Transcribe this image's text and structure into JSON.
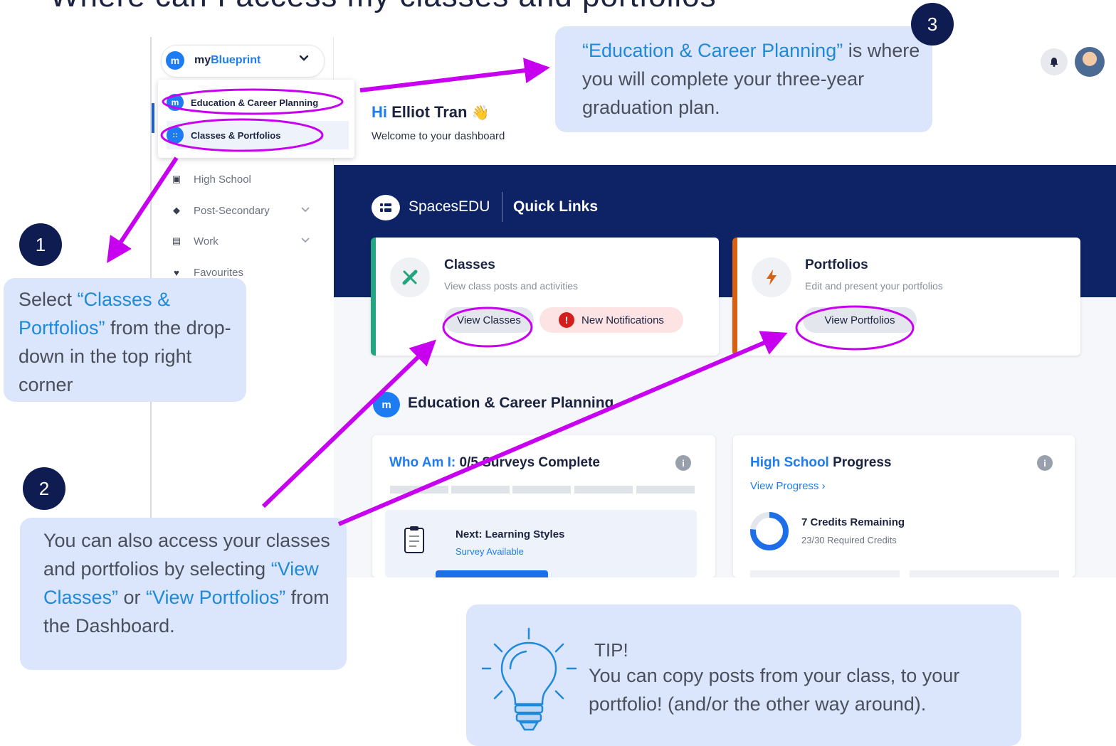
{
  "heading": "Where can I access my classes and portfolios",
  "sidebar": {
    "app_switcher": {
      "logo": "m",
      "name_prefix": "my",
      "name_brand": "Blueprint",
      "chevron": "⌄"
    },
    "dropdown": [
      {
        "label": "Education & Career Planning",
        "icon": "m"
      },
      {
        "label": "Classes & Portfolios",
        "icon": "::"
      }
    ],
    "nav": [
      {
        "label": "High School",
        "icon": "school-icon"
      },
      {
        "label": "Post-Secondary",
        "icon": "graduation-cap-icon"
      },
      {
        "label": "Work",
        "icon": "briefcase-icon"
      },
      {
        "label": "Favourites",
        "icon": "heart-icon"
      }
    ]
  },
  "header": {
    "hi": "Hi",
    "name": "Elliot Tran",
    "wave": "👋",
    "welcome": "Welcome to your dashboard"
  },
  "quick_links": {
    "brand": "SpacesEDU",
    "title": "Quick Links",
    "classes": {
      "title": "Classes",
      "subtitle": "View class posts and activities",
      "button": "View Classes",
      "notifications": "New Notifications"
    },
    "portfolios": {
      "title": "Portfolios",
      "subtitle": "Edit and present your portfolios",
      "button": "View Portfolios"
    }
  },
  "ecp": {
    "title": "Education & Career Planning",
    "who_am_i": {
      "prefix": "Who Am I:",
      "rest": "0/5 Surveys Complete",
      "segments": 5,
      "next_title": "Next: Learning Styles",
      "next_sub": "Survey Available"
    },
    "high_school": {
      "title_blue": "High School",
      "title_rest": "Progress",
      "link": "View Progress",
      "credits": "7 Credits Remaining",
      "required": "23/30 Required Credits",
      "progress_fraction": 0.767
    }
  },
  "callouts": {
    "one": {
      "number": "1",
      "pre": "Select ",
      "link": "“Classes & Portfolios”",
      "post": "  from the drop-down in the top right corner"
    },
    "two": {
      "number": "2",
      "pre": "You can also access your classes and portfolios by selecting ",
      "link1": "“View Classes”",
      "mid": " or ",
      "link2": "“View Portfolios”",
      "post": " from the Dashboard."
    },
    "three": {
      "number": "3",
      "link": "“Education & Career Planning”",
      "post": " is where you will complete your three-year graduation plan."
    },
    "tip": {
      "title": "TIP!",
      "text": "You can copy posts from your class, to your portfolio! (and/or the other way around)."
    }
  },
  "colors": {
    "navy": "#0e2366",
    "brand_blue": "#1d7cf2",
    "annotation_purple": "#c800f0",
    "callout_bg": "#dbe5fb"
  }
}
